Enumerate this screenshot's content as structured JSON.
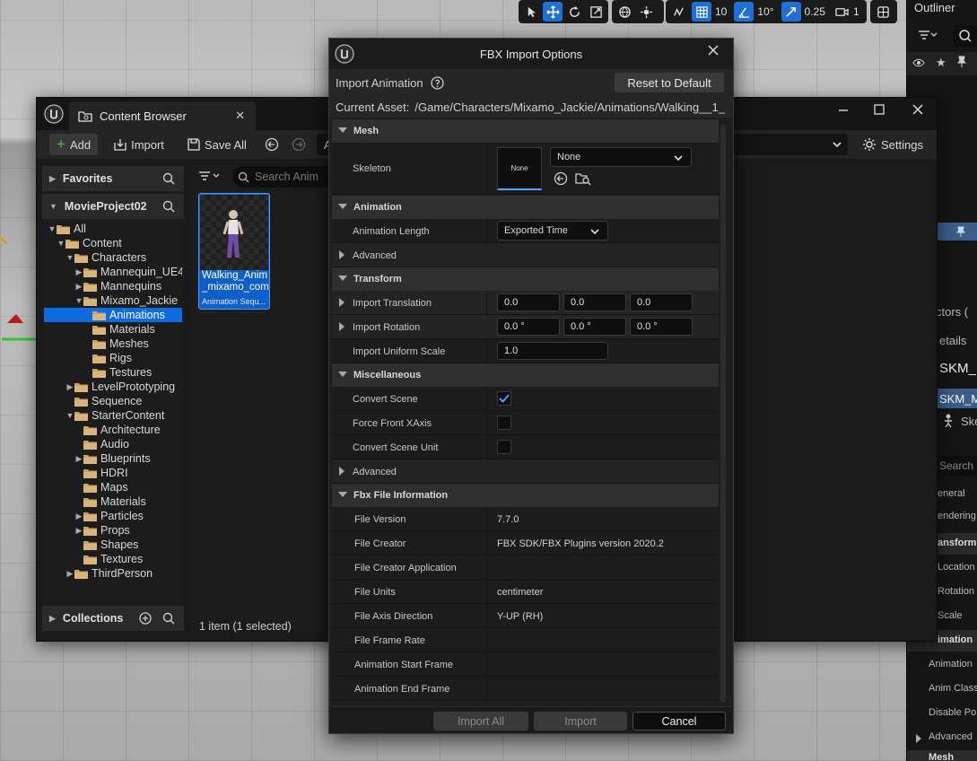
{
  "viewport_toolbar": {
    "grid_snap": "10",
    "angle_snap": "10°",
    "scale_snap": "0.25",
    "camera_speed": "1"
  },
  "outliner": {
    "title": "Outliner",
    "rows": [
      "ctors (",
      "etails",
      "SKM_I",
      "SKM_M",
      "Ske",
      "Search",
      "eneral",
      "endering",
      "ansform",
      "Location",
      "Rotation",
      "Scale",
      "imation",
      "Animation",
      "Anim Class",
      "Disable Po",
      "Advanced",
      "Mesh"
    ]
  },
  "content_browser": {
    "tab_title": "Content Browser",
    "toolbar": {
      "add": "Add",
      "import": "Import",
      "save_all": "Save All",
      "path": "All"
    },
    "settings": "Settings",
    "favorites": "Favorites",
    "project": "MovieProject02",
    "tree": [
      {
        "label": "All",
        "depth": 0,
        "arrow": "open"
      },
      {
        "label": "Content",
        "depth": 1,
        "arrow": "open"
      },
      {
        "label": "Characters",
        "depth": 2,
        "arrow": "open"
      },
      {
        "label": "Mannequin_UE4",
        "depth": 3,
        "arrow": "closed"
      },
      {
        "label": "Mannequins",
        "depth": 3,
        "arrow": "closed"
      },
      {
        "label": "Mixamo_Jackie",
        "depth": 3,
        "arrow": "open"
      },
      {
        "label": "Animations",
        "depth": 4,
        "arrow": "none",
        "selected": true
      },
      {
        "label": "Materials",
        "depth": 4,
        "arrow": "none"
      },
      {
        "label": "Meshes",
        "depth": 4,
        "arrow": "none"
      },
      {
        "label": "Rigs",
        "depth": 4,
        "arrow": "none"
      },
      {
        "label": "Testures",
        "depth": 4,
        "arrow": "none"
      },
      {
        "label": "LevelPrototyping",
        "depth": 2,
        "arrow": "closed"
      },
      {
        "label": "Sequence",
        "depth": 2,
        "arrow": "none"
      },
      {
        "label": "StarterContent",
        "depth": 2,
        "arrow": "open"
      },
      {
        "label": "Architecture",
        "depth": 3,
        "arrow": "none"
      },
      {
        "label": "Audio",
        "depth": 3,
        "arrow": "none"
      },
      {
        "label": "Blueprints",
        "depth": 3,
        "arrow": "closed"
      },
      {
        "label": "HDRI",
        "depth": 3,
        "arrow": "none"
      },
      {
        "label": "Maps",
        "depth": 3,
        "arrow": "none"
      },
      {
        "label": "Materials",
        "depth": 3,
        "arrow": "none"
      },
      {
        "label": "Particles",
        "depth": 3,
        "arrow": "closed"
      },
      {
        "label": "Props",
        "depth": 3,
        "arrow": "closed"
      },
      {
        "label": "Shapes",
        "depth": 3,
        "arrow": "none"
      },
      {
        "label": "Textures",
        "depth": 3,
        "arrow": "none"
      },
      {
        "label": "ThirdPerson",
        "depth": 2,
        "arrow": "closed"
      }
    ],
    "collections": "Collections",
    "search_placeholder": "Search Anim",
    "asset": {
      "name_line1": "Walking_Anim",
      "name_line2": "_mixamo_com",
      "type": "Animation Sequ..."
    },
    "status": "1 item (1 selected)"
  },
  "dialog": {
    "title": "FBX Import Options",
    "import_animation": "Import Animation",
    "reset": "Reset to Default",
    "current_asset_label": "Current Asset:",
    "current_asset_path": "/Game/Characters/Mixamo_Jackie/Animations/Walking__1_",
    "mesh": {
      "header": "Mesh",
      "skeleton_label": "Skeleton",
      "skeleton_thumb": "None",
      "skeleton_value": "None"
    },
    "animation": {
      "header": "Animation",
      "length_label": "Animation Length",
      "length_value": "Exported Time",
      "advanced": "Advanced"
    },
    "transform": {
      "header": "Transform",
      "translation_label": "Import Translation",
      "translation": [
        "0.0",
        "0.0",
        "0.0"
      ],
      "rotation_label": "Import Rotation",
      "rotation": [
        "0.0 °",
        "0.0 °",
        "0.0 °"
      ],
      "scale_label": "Import Uniform Scale",
      "scale": "1.0"
    },
    "misc": {
      "header": "Miscellaneous",
      "convert_scene": "Convert Scene",
      "convert_scene_checked": true,
      "force_front": "Force Front XAxis",
      "force_front_checked": false,
      "convert_unit": "Convert Scene Unit",
      "convert_unit_checked": false,
      "advanced": "Advanced"
    },
    "fbx_info": {
      "header": "Fbx File Information",
      "rows": [
        {
          "label": "File Version",
          "value": "7.7.0"
        },
        {
          "label": "File Creator",
          "value": "FBX SDK/FBX Plugins version 2020.2"
        },
        {
          "label": "File Creator Application",
          "value": ""
        },
        {
          "label": "File Units",
          "value": "centimeter"
        },
        {
          "label": "File Axis Direction",
          "value": "Y-UP (RH)"
        },
        {
          "label": "File Frame Rate",
          "value": ""
        },
        {
          "label": "Animation Start Frame",
          "value": ""
        },
        {
          "label": "Animation End Frame",
          "value": ""
        }
      ]
    },
    "buttons": {
      "import_all": "Import All",
      "import": "Import",
      "cancel": "Cancel"
    }
  }
}
